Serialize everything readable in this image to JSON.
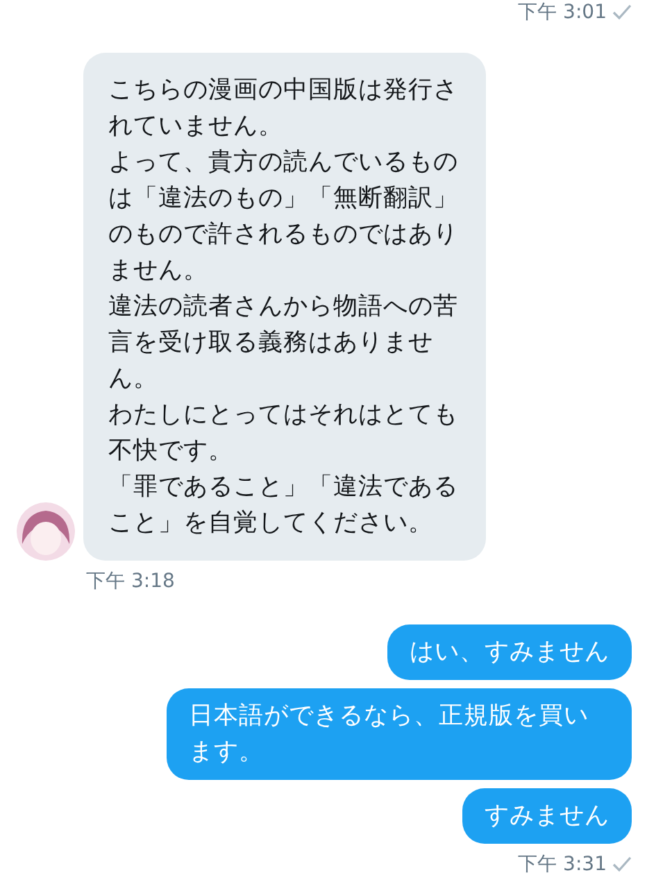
{
  "messages": [
    {
      "kind": "sent_time",
      "text": "下午 3:01",
      "read": true
    },
    {
      "kind": "received",
      "paragraphs": [
        "こちらの漫画の中国版は発行されていません。",
        "よって、貴方の読んでいるものは「違法のもの」「無断翻訳」のもので許されるものではありません。",
        "違法の読者さんから物語への苦言を受け取る義務はありません。",
        "わたしにとってはそれはとても不快です。",
        "「罪であること」「違法であること」を自覚してください。"
      ]
    },
    {
      "kind": "received_time",
      "text": "下午 3:18"
    },
    {
      "kind": "sent",
      "paragraphs": [
        "はい、すみません"
      ]
    },
    {
      "kind": "sent",
      "paragraphs": [
        "日本語ができるなら、正規版を買います。"
      ]
    },
    {
      "kind": "sent",
      "paragraphs": [
        "すみません"
      ]
    },
    {
      "kind": "sent_time",
      "text": "下午 3:31",
      "read": true
    }
  ]
}
